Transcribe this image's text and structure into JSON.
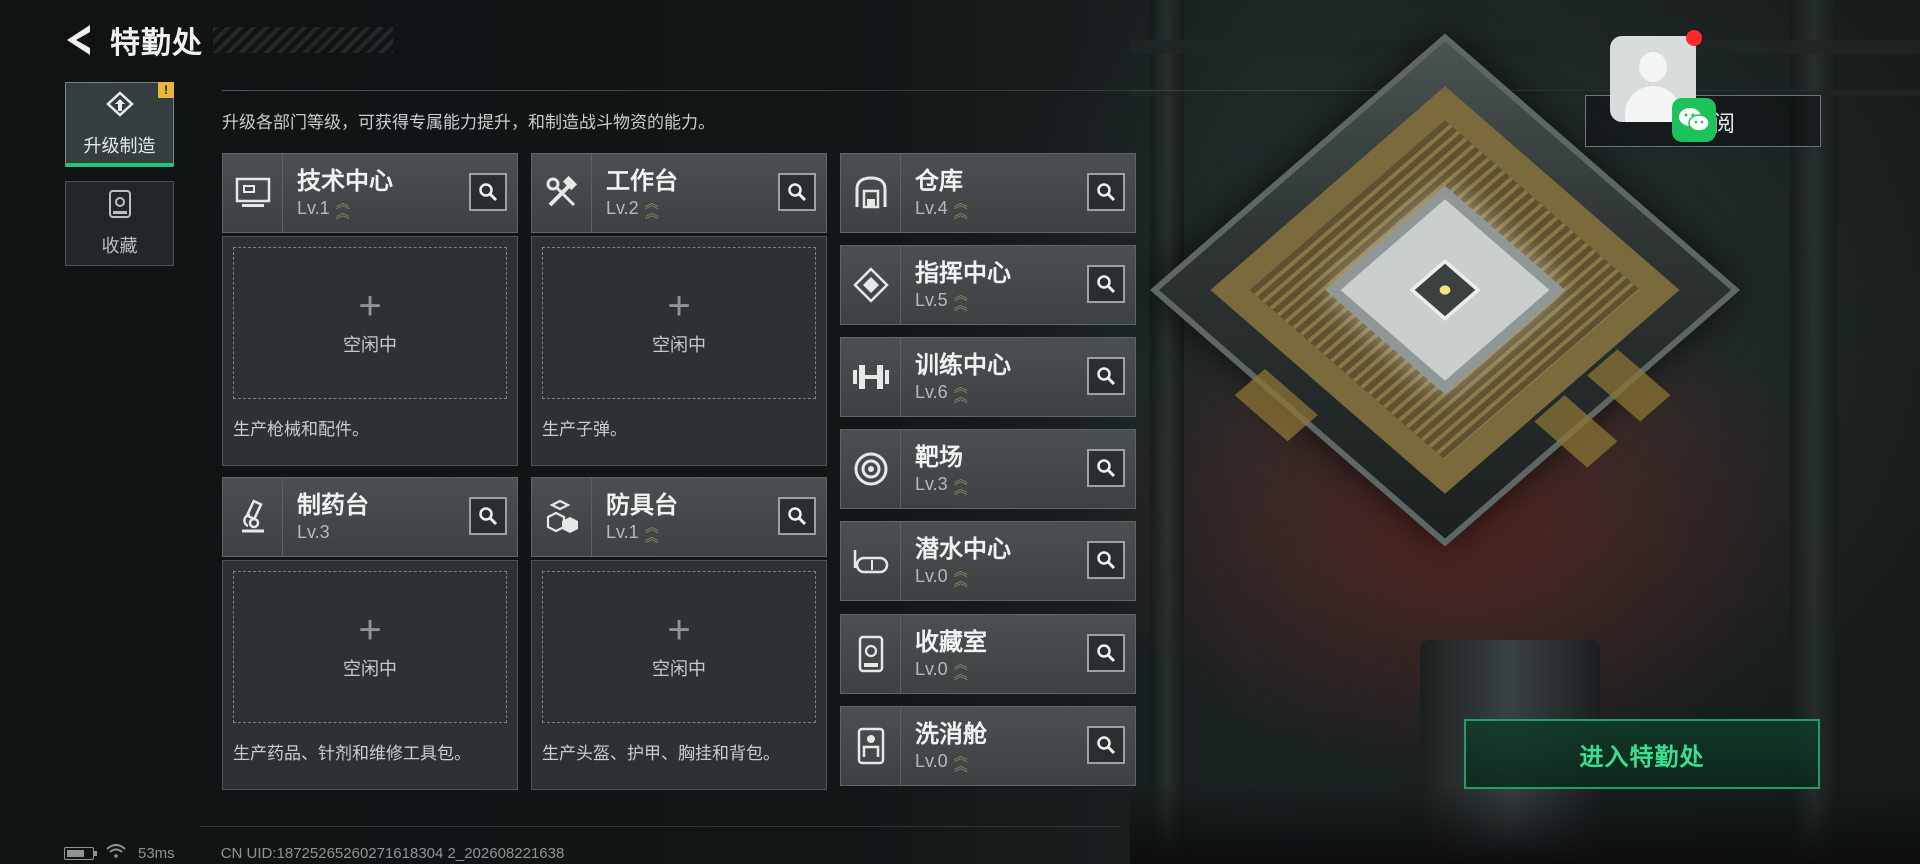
{
  "header": {
    "title": "特勤处"
  },
  "tabs": [
    {
      "label": "升级制造",
      "active": true,
      "badge": "!"
    },
    {
      "label": "收藏",
      "active": false
    }
  ],
  "description": "升级各部门等级，可获得专属能力提升，和制造战斗物资的能力。",
  "production_depts": [
    {
      "name": "技术中心",
      "level": "Lv.1",
      "icon": "computer-terminal-icon",
      "slot_status": "空闲中",
      "desc": "生产枪械和配件。"
    },
    {
      "name": "工作台",
      "level": "Lv.2",
      "icon": "hammer-wrench-icon",
      "slot_status": "空闲中",
      "desc": "生产子弹。"
    },
    {
      "name": "制药台",
      "level": "Lv.3",
      "icon": "microscope-icon",
      "slot_status": "空闲中",
      "desc": "生产药品、针剂和维修工具包。"
    },
    {
      "name": "防具台",
      "level": "Lv.1",
      "icon": "armor-blocks-icon",
      "slot_status": "空闲中",
      "desc": "生产头盔、护甲、胸挂和背包。"
    }
  ],
  "other_depts": [
    {
      "name": "仓库",
      "level": "Lv.4",
      "icon": "warehouse-icon"
    },
    {
      "name": "指挥中心",
      "level": "Lv.5",
      "icon": "command-diamond-icon"
    },
    {
      "name": "训练中心",
      "level": "Lv.6",
      "icon": "dumbbell-icon"
    },
    {
      "name": "靶场",
      "level": "Lv.3",
      "icon": "target-icon"
    },
    {
      "name": "潜水中心",
      "level": "Lv.0",
      "icon": "diving-goggles-icon"
    },
    {
      "name": "收藏室",
      "level": "Lv.0",
      "icon": "display-case-icon"
    },
    {
      "name": "洗消舱",
      "level": "Lv.0",
      "icon": "decon-suit-icon"
    }
  ],
  "subscribe": {
    "label": "阅"
  },
  "enter_button": {
    "label": "进入特勤处"
  },
  "status": {
    "ping": "53ms",
    "uid": "CN UID:18725265260271618304 2_202608221638"
  },
  "colors": {
    "accent": "#21c67a",
    "alert": "#e7b73b",
    "level_chevron": "#8a8d5d"
  }
}
